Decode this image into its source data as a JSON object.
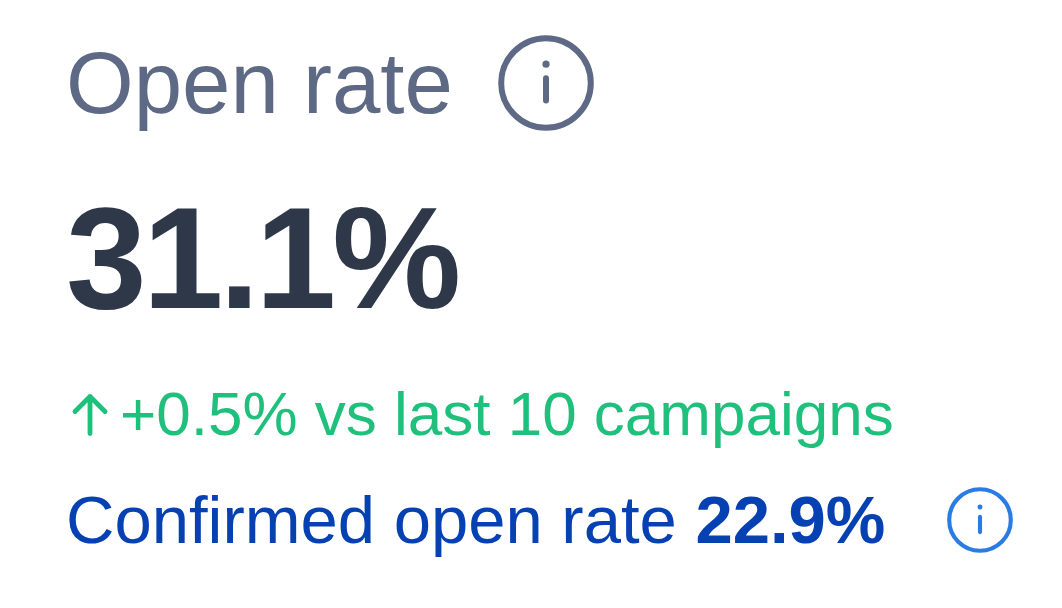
{
  "metric": {
    "title": "Open rate",
    "value": "31.1%"
  },
  "change": {
    "positive": true,
    "text": "+0.5% vs last 10 campaigns"
  },
  "confirmed": {
    "text": "Confirmed open rate **22.9%**"
  }
}
